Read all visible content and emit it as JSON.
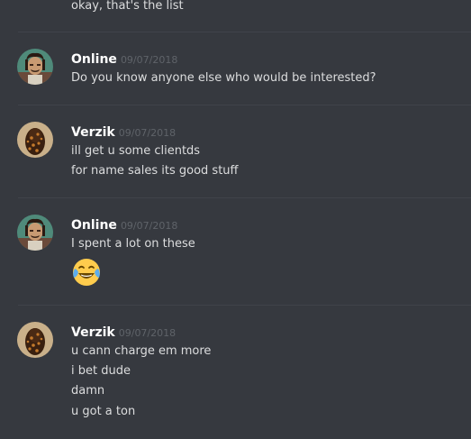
{
  "messages": [
    {
      "lines": [
        "okay, that's the list"
      ]
    },
    {
      "username": "Online",
      "timestamp": "09/07/2018",
      "avatar_icon": "online-avatar-icon",
      "lines": [
        "Do you know anyone else who would be interested?"
      ]
    },
    {
      "username": "Verzik",
      "timestamp": "09/07/2018",
      "avatar_icon": "verzik-avatar-icon",
      "lines": [
        "ill get u some clientds",
        "for name sales its good stuff"
      ]
    },
    {
      "username": "Online",
      "timestamp": "09/07/2018",
      "avatar_icon": "online-avatar-icon",
      "lines": [
        "I spent a lot on these"
      ],
      "emoji": "face-with-tears-of-joy-emoji"
    },
    {
      "username": "Verzik",
      "timestamp": "09/07/2018",
      "avatar_icon": "verzik-avatar-icon",
      "lines": [
        "u cann charge em more",
        "i bet dude",
        "damn",
        "u got a ton"
      ]
    }
  ],
  "colors": {
    "background": "#36393f",
    "username": "#ffffff",
    "timestamp": "#5f6369",
    "text": "#dcddde",
    "divider": "#40434a"
  }
}
